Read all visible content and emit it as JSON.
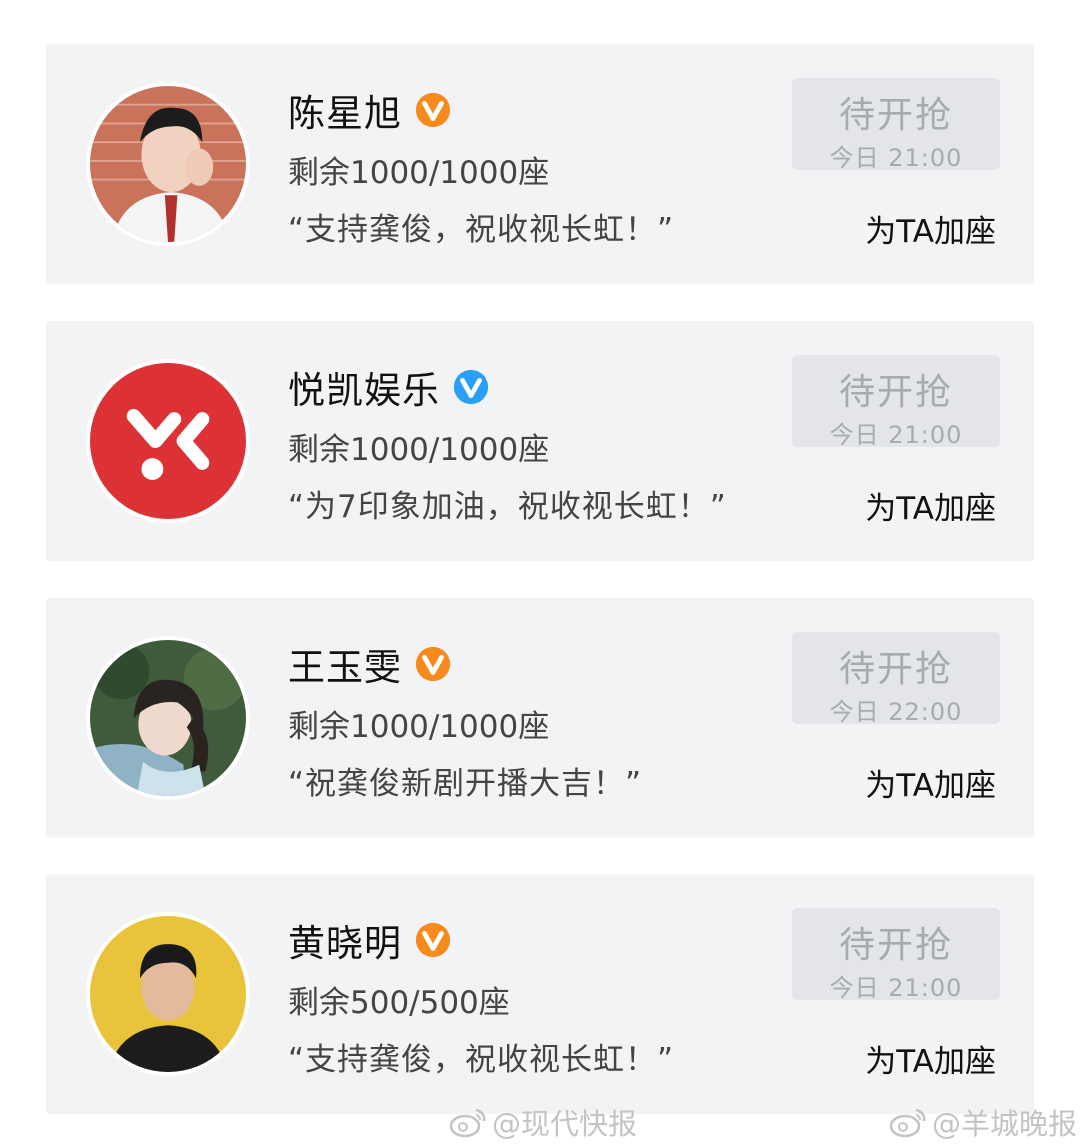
{
  "cards": [
    {
      "name": "陈星旭",
      "badge_color": "#f78a1d",
      "seats": "剩余1000/1000座",
      "message": "“支持龚俊，祝收视长虹！”",
      "button_label": "待开抢",
      "button_time": "今日 21:00",
      "action_label": "为TA加座"
    },
    {
      "name": "悦凯娱乐",
      "badge_color": "#2a9ff6",
      "seats": "剩余1000/1000座",
      "message": "“为7印象加油，祝收视长虹！”",
      "button_label": "待开抢",
      "button_time": "今日 21:00",
      "action_label": "为TA加座"
    },
    {
      "name": "王玉雯",
      "badge_color": "#f78a1d",
      "seats": "剩余1000/1000座",
      "message": "“祝龚俊新剧开播大吉！”",
      "button_label": "待开抢",
      "button_time": "今日 22:00",
      "action_label": "为TA加座"
    },
    {
      "name": "黄晓明",
      "badge_color": "#f78a1d",
      "seats": "剩余500/500座",
      "message": "“支持龚俊，祝收视长虹！”",
      "button_label": "待开抢",
      "button_time": "今日 21:00",
      "action_label": "为TA加座"
    }
  ],
  "watermarks": [
    "@现代快报",
    "@羊城晚报"
  ]
}
